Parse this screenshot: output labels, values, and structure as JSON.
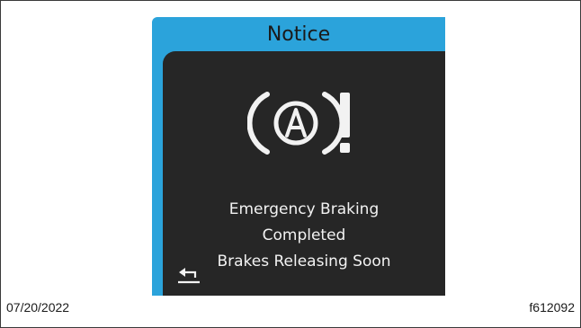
{
  "display": {
    "title": "Notice",
    "icon": "brake-assist-warning-icon",
    "message_lines": [
      "Emergency Braking",
      "Completed",
      "Brakes Releasing Soon"
    ],
    "back_icon": "back-arrow-icon",
    "colors": {
      "header": "#2ba3db",
      "panel": "#262626",
      "text": "#f2f2f2"
    }
  },
  "caption": {
    "date": "07/20/2022",
    "figure_id": "f612092"
  }
}
